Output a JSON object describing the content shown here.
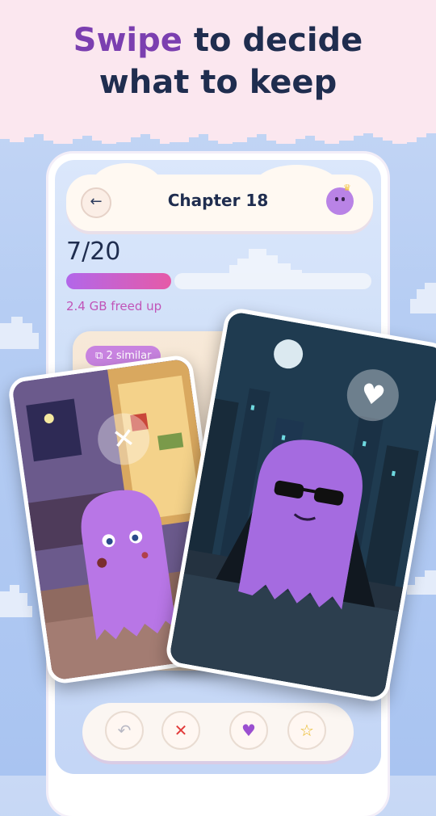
{
  "hero": {
    "title_accent": "Swipe",
    "title_rest_1": " to decide",
    "title_line_2": "what to keep"
  },
  "nav": {
    "back_icon": "arrow-left-icon",
    "chapter_title": "Chapter 18",
    "avatar_icon": "ghost-avatar-icon"
  },
  "progress": {
    "count_text": "7/20",
    "fraction": 0.35,
    "freed_text": "2.4 GB freed up"
  },
  "stack": {
    "similar_badge": "2 similar",
    "similar_icon": "copy-icon"
  },
  "cards": {
    "left_indicator": "x-icon",
    "right_indicator": "heart-icon"
  },
  "actions": {
    "undo_icon": "undo-icon",
    "reject_icon": "x-icon",
    "keep_icon": "heart-icon",
    "favorite_icon": "star-icon",
    "undo_glyph": "↶",
    "reject_glyph": "✕",
    "keep_glyph": "♥",
    "favorite_glyph": "☆"
  },
  "colors": {
    "accent_purple": "#7b3fb0",
    "title_navy": "#1f2d4f",
    "freed_pink": "#c054b8",
    "reject_red": "#e23b3b",
    "keep_purple": "#9b4fd0",
    "star_yellow": "#e8b923"
  }
}
